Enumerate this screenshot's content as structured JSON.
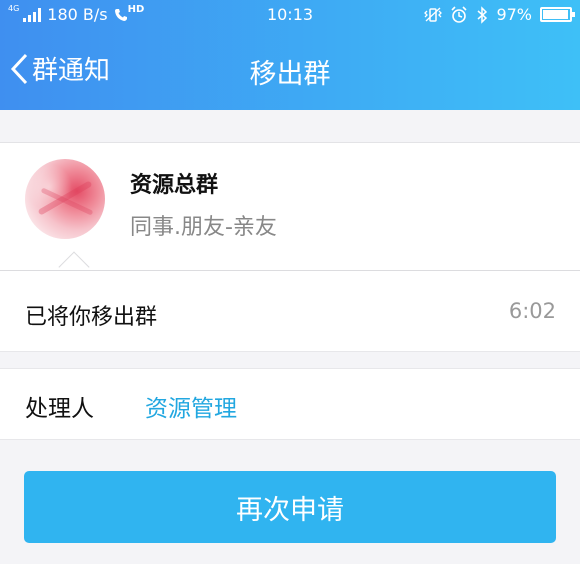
{
  "status_bar": {
    "network_tag": "4G",
    "speed": "180 B/s",
    "hd_tag": "HD",
    "time": "10:13",
    "battery": "97%",
    "battery_level": 0.97
  },
  "nav": {
    "back_label": "群通知",
    "title": "移出群"
  },
  "group": {
    "name": "资源总群",
    "subtitle": "同事.朋友-亲友"
  },
  "message": {
    "text": "已将你移出群",
    "time": "6:02"
  },
  "handler": {
    "label": "处理人",
    "name": "资源管理"
  },
  "action": {
    "reapply_label": "再次申请"
  },
  "colors": {
    "header_start": "#3f8ff0",
    "header_end": "#3ec0f7",
    "button": "#30b4f0",
    "link": "#22a7e0"
  }
}
